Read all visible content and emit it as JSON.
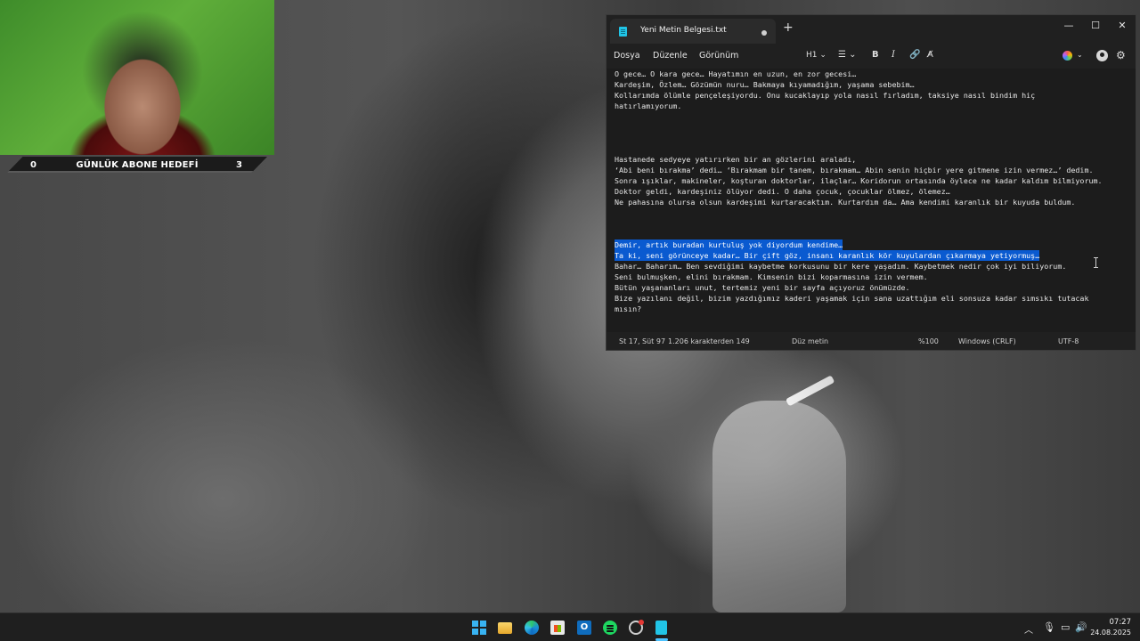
{
  "overlay": {
    "goal_left": "0",
    "goal_label": "GÜNLÜK ABONE HEDEFİ",
    "goal_right": "3"
  },
  "notepad": {
    "tab_title": "Yeni Metin Belgesi.txt",
    "new_tab": "+",
    "window_controls": {
      "minimize": "—",
      "maximize": "☐",
      "close": "✕"
    },
    "menu": {
      "file": "Dosya",
      "edit": "Düzenle",
      "view": "Görünüm"
    },
    "toolbar": {
      "heading": "H1 ⌄",
      "list": "☰ ⌄",
      "bold": "B",
      "italic": "I",
      "link": "🔗",
      "clear_format": "A̸",
      "copilot_caret": "⌄",
      "settings": "⚙"
    },
    "lines": [
      "O gece… O kara gece… Hayatımın en uzun, en zor gecesi…",
      "Kardeşim, Özlem… Gözümün nuru… Bakmaya kıyamadığım, yaşama sebebim…",
      "Kollarımda ölümle pençeleşiyordu. Onu kucaklayıp yola nasıl fırladım, taksiye nasıl bindim hiç",
      "hatırlamıyorum.",
      "Hastanede sedyeye yatırırken bir an gözlerini araladı,",
      "‘Abi beni bırakma’ dedi… ‘Bırakmam bir tanem, bırakmam… Abin senin hiçbir yere gitmene izin vermez…’ dedim.",
      "Sonra ışıklar, makineler, koşturan doktorlar, ilaçlar… Koridorun ortasında öylece ne kadar kaldım bilmiyorum.",
      "Doktor geldi, kardeşiniz ölüyor dedi. O daha çocuk, çocuklar ölmez, ölemez…",
      "Ne pahasına olursa olsun kardeşimi kurtaracaktım. Kurtardım da… Ama kendimi karanlık bir kuyuda buldum.",
      "Demir, artık buradan kurtuluş yok diyordum kendime…",
      "Ta ki, seni görünceye kadar… Bir çift göz, insanı karanlık kör kuyulardan çıkarmaya yetiyormuş…",
      "Bahar… Baharım… Ben sevdiğimi kaybetme korkusunu bir kere yaşadım. Kaybetmek nedir çok iyi biliyorum.",
      "Seni bulmuşken, elini bırakmam. Kimsenin bizi koparmasına izin vermem.",
      "Bütün yaşananları unut, tertemiz yeni bir sayfa açıyoruz önümüzde.",
      "Bize yazılanı değil, bizim yazdığımız kaderi yaşamak için sana uzattığım eli sonsuza kadar sımsıkı tutacak",
      "mısın?"
    ],
    "status": {
      "position": "St 17, Süt 97",
      "count": "1.206 karakterden 149",
      "format": "Düz metin",
      "zoom": "%100",
      "line_ending": "Windows (CRLF)",
      "encoding": "UTF-8"
    }
  },
  "taskbar": {
    "outlook_letter": "O",
    "tray": {
      "chevron": "︿",
      "mic": "🎙",
      "monitor": "▭",
      "volume": "🔊"
    },
    "clock_time": "07:27",
    "clock_date": "24.08.2025"
  }
}
